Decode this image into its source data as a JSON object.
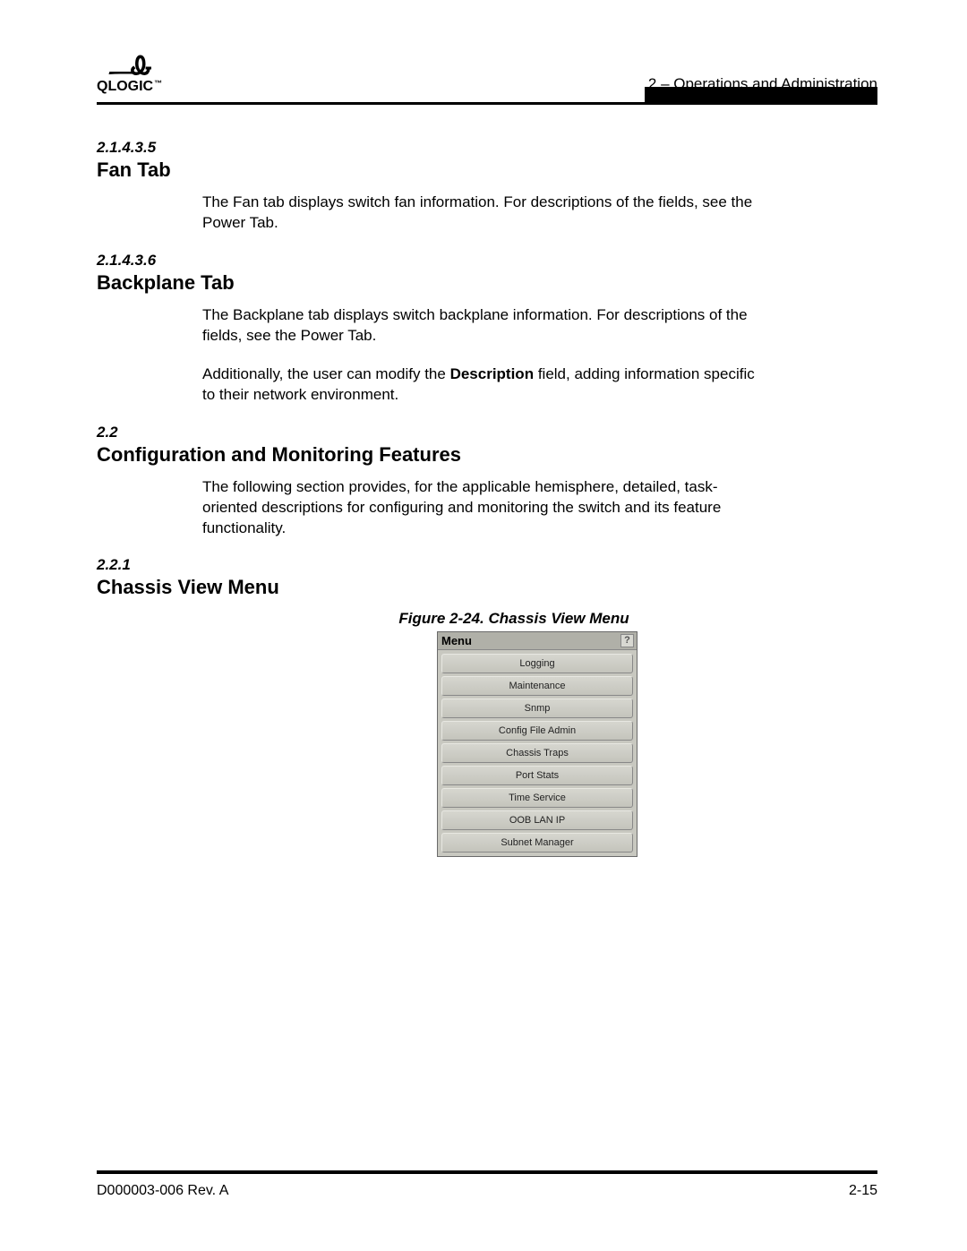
{
  "header": {
    "chapter": "2 – Operations and Administration",
    "logo_text": "QLOGIC"
  },
  "sections": {
    "s1": {
      "num": "2.1.4.3.5",
      "title": "Fan Tab"
    },
    "s2": {
      "num": "2.1.4.3.6",
      "title": "Backplane Tab"
    },
    "s3": {
      "num": "2.2",
      "title": "Configuration and Monitoring Features"
    },
    "s4": {
      "num": "2.2.1",
      "title": "Chassis View Menu"
    }
  },
  "paragraphs": {
    "p1": "The Fan tab displays switch fan information. For descriptions of the fields, see the Power Tab.",
    "p2": "The Backplane tab displays switch backplane information. For descriptions of the fields, see the Power Tab.",
    "p3a": "Additionally, the user can modify the ",
    "p3b": "Description",
    "p3c": " field, adding information specific to their network environment.",
    "p4": "The following section provides, for the applicable hemisphere, detailed, task-oriented descriptions for configuring and monitoring the switch and its feature functionality."
  },
  "figure": {
    "caption": "Figure 2-24. Chassis View Menu",
    "menu_label": "Menu",
    "help": "?",
    "items": {
      "i0": "Logging",
      "i1": "Maintenance",
      "i2": "Snmp",
      "i3": "Config File Admin",
      "i4": "Chassis Traps",
      "i5": "Port Stats",
      "i6": "Time Service",
      "i7": "OOB LAN IP",
      "i8": "Subnet Manager"
    }
  },
  "footer": {
    "doc_id": "D000003-006 Rev. A",
    "page_num": "2-15"
  }
}
